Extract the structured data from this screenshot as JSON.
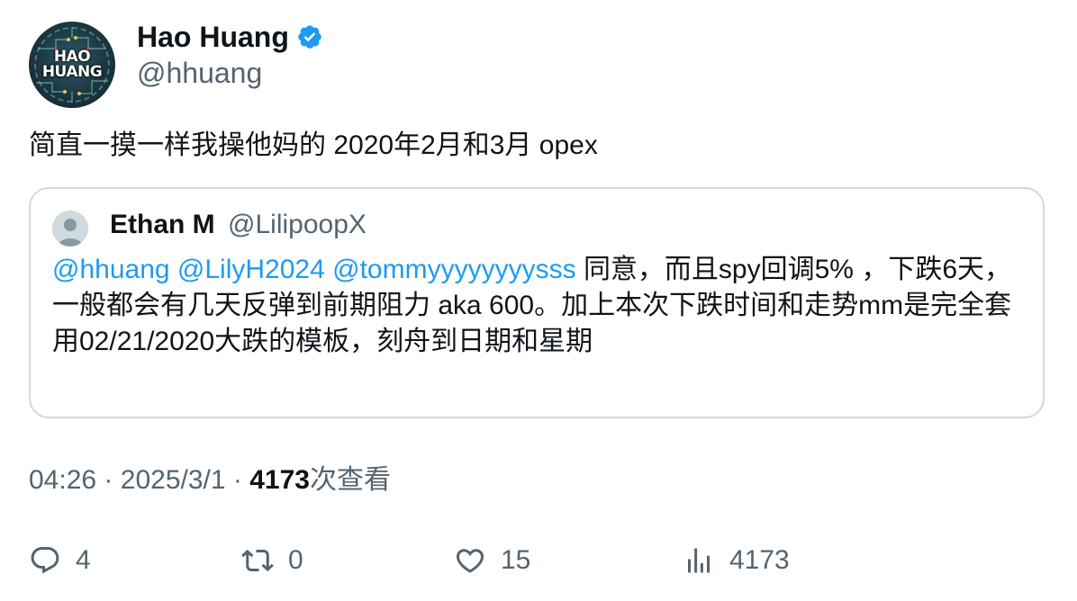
{
  "author": {
    "avatar_text_line1": "HAO",
    "avatar_text_line2": "HUANG",
    "name": "Hao Huang",
    "handle": "@hhuang",
    "verified_icon": "verified-badge-icon",
    "verified_color": "#1d9bf0"
  },
  "tweet": {
    "text": "简直一摸一样我操他妈的 2020年2月和3月 opex"
  },
  "quote": {
    "name": "Ethan M",
    "handle": "@LilipoopX",
    "mentions": [
      "@hhuang",
      "@LilyH2024",
      "@tommyyyyyyyysss"
    ],
    "text": "同意，而且spy回调5% ，下跌6天，一般都会有几天反弹到前期阻力 aka 600。加上本次下跌时间和走势mm是完全套用02/21/2020大跌的模板，刻舟到日期和星期"
  },
  "meta": {
    "time": "04:26",
    "separator": "·",
    "date": "2025/3/1",
    "views_count": "4173",
    "views_label": "次查看"
  },
  "actions": {
    "reply_count": "4",
    "retweet_count": "0",
    "like_count": "15",
    "views_count": "4173"
  },
  "colors": {
    "link": "#1d9bf0",
    "secondary_text": "#536471",
    "primary_text": "#0f1419",
    "border": "#cfd9de"
  }
}
